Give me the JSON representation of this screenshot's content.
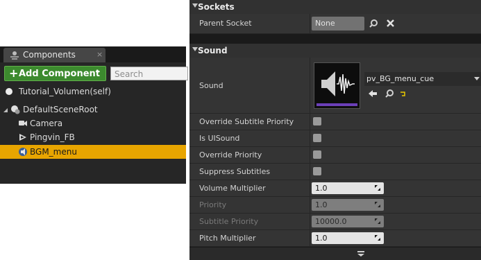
{
  "components": {
    "tab_label": "Components",
    "tab_close": "×",
    "add_label": "Add Component",
    "add_plus": "+",
    "add_caret": "▾",
    "search_placeholder": "Search",
    "root_label": "Tutorial_Volumen(self)",
    "tree": [
      {
        "label": "DefaultSceneRoot",
        "icon": "scene-root-icon"
      },
      {
        "label": "Camera",
        "icon": "camera-icon"
      },
      {
        "label": "Pingvin_FB",
        "icon": "mesh-icon"
      },
      {
        "label": "BGM_menu",
        "icon": "audio-icon",
        "selected": true
      }
    ]
  },
  "details": {
    "sockets": {
      "title": "Sockets",
      "parent_socket_label": "Parent Socket",
      "parent_socket_value": "None"
    },
    "sound": {
      "title": "Sound",
      "sound_label": "Sound",
      "asset_name": "pv_BG_menu_cue",
      "checkboxes": [
        {
          "label": "Override Subtitle Priority",
          "checked": false
        },
        {
          "label": "Is UISound",
          "checked": false
        },
        {
          "label": "Override Priority",
          "checked": false
        },
        {
          "label": "Suppress Subtitles",
          "checked": false
        }
      ],
      "numbers": [
        {
          "label": "Volume Multiplier",
          "value": "1.0",
          "disabled": false
        },
        {
          "label": "Priority",
          "value": "1.0",
          "disabled": true
        },
        {
          "label": "Subtitle Priority",
          "value": "10000.0",
          "disabled": true
        },
        {
          "label": "Pitch Multiplier",
          "value": "1.0",
          "disabled": false
        }
      ]
    }
  },
  "colors": {
    "accent_selected": "#e8a500",
    "add_button": "#3c8a2e"
  }
}
